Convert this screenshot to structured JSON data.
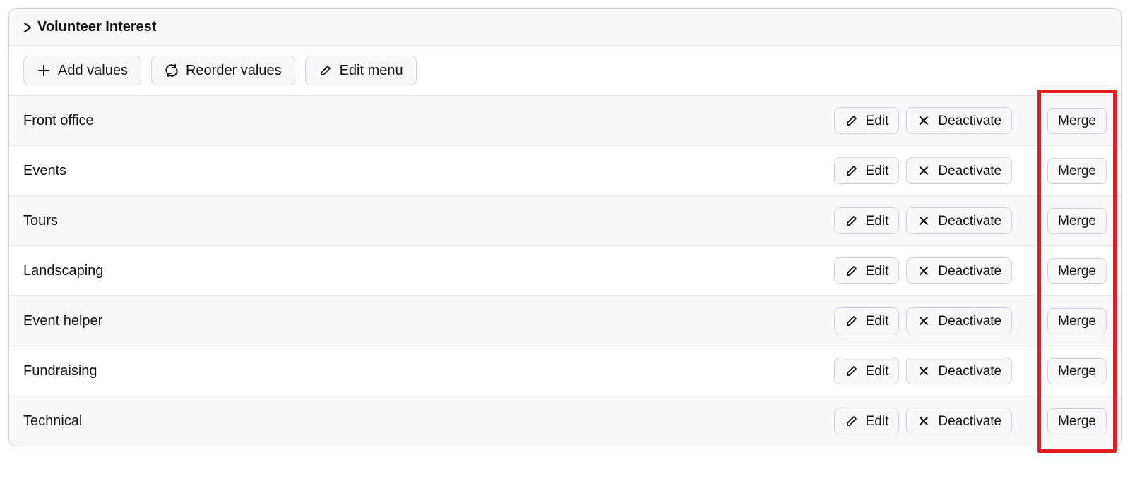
{
  "header": {
    "title": "Volunteer Interest"
  },
  "toolbar": {
    "add_values_label": "Add values",
    "reorder_values_label": "Reorder values",
    "edit_menu_label": "Edit menu"
  },
  "row_action_labels": {
    "edit": "Edit",
    "deactivate": "Deactivate",
    "merge": "Merge"
  },
  "items": [
    {
      "label": "Front office"
    },
    {
      "label": "Events"
    },
    {
      "label": "Tours"
    },
    {
      "label": "Landscaping"
    },
    {
      "label": "Event helper"
    },
    {
      "label": "Fundraising"
    },
    {
      "label": "Technical"
    }
  ]
}
